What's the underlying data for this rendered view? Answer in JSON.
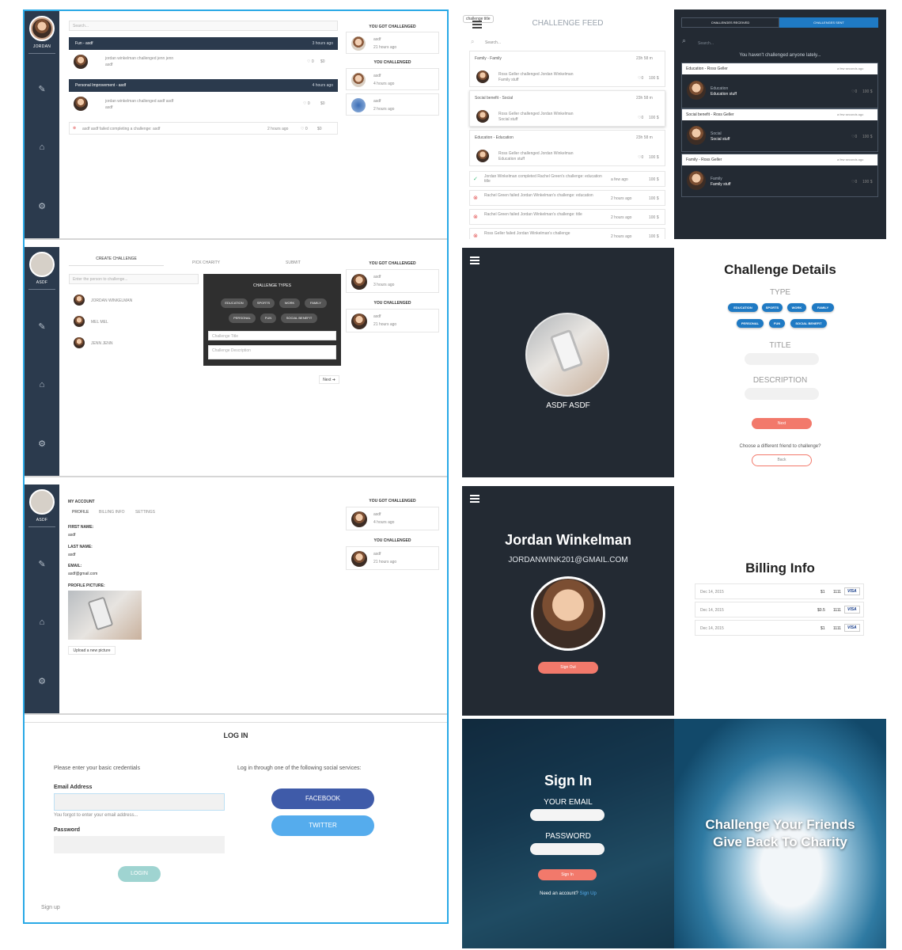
{
  "user": {
    "name": "JORDAN",
    "short": "ASDF"
  },
  "feed1": {
    "search_placeholder": "Search...",
    "groups": [
      {
        "title": "Fun - asdf",
        "time": "3 hours ago",
        "text": "jordan winkelman challenged jenn jenn",
        "sub": "asdf",
        "likes": "0",
        "amount": "$0",
        "money": "$0"
      },
      {
        "title": "Personal Improvement - asdf",
        "time": "4 hours ago",
        "text": "jordan winkelman challenged asdf asdf",
        "sub": "asdf",
        "likes": "0",
        "money": "$0"
      }
    ],
    "failed_text": "asdf asdf failed completing a challenge: asdf",
    "failed_time": "2 hours ago",
    "failed_likes": "0",
    "failed_money": "$0"
  },
  "right_col": {
    "got_challenged": "YOU GOT CHALLENGED",
    "you_challenged": "YOU CHALLENGED",
    "item_text": "asdf",
    "times": [
      "21 hours ago",
      "4 hours ago",
      "2 hours ago",
      "3 hours ago",
      "21 hours ago",
      "4 hours ago"
    ]
  },
  "create": {
    "tabs": [
      "CREATE CHALLENGE",
      "PICK CHARITY",
      "SUBMIT"
    ],
    "search_placeholder": "Enter the person to challenge...",
    "people": [
      "JORDAN WINKELMAN",
      "MEL MEL",
      "JENN JENN"
    ],
    "types_title": "CHALLENGE TYPES",
    "types": [
      "EDUCATION",
      "SPORTS",
      "WORK",
      "FAMILY",
      "PERSONAL",
      "FUN",
      "SOCIAL BENEFIT"
    ],
    "title_placeholder": "Challenge Title",
    "desc_placeholder": "Challenge Description",
    "next": "Next"
  },
  "account": {
    "title": "MY ACCOUNT",
    "tabs": [
      "PROFILE",
      "BILLING INFO",
      "SETTINGS"
    ],
    "first_label": "FIRST NAME:",
    "first_val": "asdf",
    "last_label": "LAST NAME:",
    "last_val": "asdf",
    "email_label": "EMAIL:",
    "email_val": "asdf@gmail.com",
    "pic_label": "PROFILE PICTURE:",
    "upload": "Upload a new picture"
  },
  "login": {
    "title": "LOG IN",
    "left_hint": "Please enter your basic credentials",
    "right_hint": "Log in through one of the following social services:",
    "email_label": "Email Address",
    "error": "You forgot to enter your email address...",
    "password_label": "Password",
    "facebook": "FACEBOOK",
    "twitter": "TWITTER",
    "login": "LOGIN",
    "signup": "Sign up"
  },
  "mobile_feed": {
    "tooltip": "challenge title",
    "title": "CHALLENGE FEED",
    "search_placeholder": "Search...",
    "groups": [
      {
        "title": "Family - Family",
        "time": "23h 58 m",
        "text": "Ross Geller challenged Jordan Winkelman",
        "sub": "Family stuff",
        "money": "100 $"
      },
      {
        "title": "Social benefit - Social",
        "time": "23h 58 m",
        "text": "Ross Geller challenged Jordan Winkelman",
        "sub": "Social stuff",
        "money": "100 $"
      },
      {
        "title": "Education - Education",
        "time": "23h 58 m",
        "text": "Ross Geller challenged Jordan Winkelman",
        "sub": "Education stuff",
        "money": "100 $"
      }
    ],
    "events": [
      {
        "text": "Jordan Winkelman completed Rachel Green's challenge: education title",
        "time": "a few ago",
        "money": "100 $",
        "ok": true
      },
      {
        "text": "Rachel Green failed Jordan Winkelman's challenge: education",
        "time": "2 hours ago",
        "money": "100 $",
        "ok": false
      },
      {
        "text": "Rachel Green failed Jordan Winkelman's challenge: title",
        "time": "2 hours ago",
        "money": "100 $",
        "ok": false
      },
      {
        "text": "Ross Geller failed Jordan Winkelman's challenge",
        "time": "2 hours ago",
        "money": "100 $",
        "ok": false
      }
    ]
  },
  "sent": {
    "tab_received": "CHALLENGES RECEIVED",
    "tab_sent": "CHALLENGES SENT",
    "search_placeholder": "Search...",
    "empty": "You haven't challenged anyone lately...",
    "items": [
      {
        "title": "Education - Ross Geller",
        "time": "a few seconds ago",
        "name": "Education",
        "sub": "Education stuff",
        "money": "100 $"
      },
      {
        "title": "Social benefit - Ross Geller",
        "time": "a few seconds ago",
        "name": "Social",
        "sub": "Social stuff",
        "money": "100 $"
      },
      {
        "title": "Family - Ross Geller",
        "time": "a few seconds ago",
        "name": "Family",
        "sub": "Family stuff",
        "money": "100 $"
      }
    ]
  },
  "profile_mobile": {
    "name": "ASDF ASDF"
  },
  "details": {
    "title": "Challenge Details",
    "type_label": "TYPE",
    "types": [
      "EDUCATION",
      "SPORTS",
      "WORK",
      "FAMILY",
      "PERSONAL",
      "FUN",
      "SOCIAL BENEFIT"
    ],
    "title_label": "TITLE",
    "desc_label": "DESCRIPTION",
    "next": "Next",
    "question": "Choose a different friend to challenge?",
    "back": "Back"
  },
  "jordan": {
    "name": "Jordan Winkelman",
    "email": "JORDANWINK201@GMAIL.COM",
    "signout": "Sign Out"
  },
  "billing": {
    "title": "Billing Info",
    "rows": [
      {
        "date": "Dec 14, 2015",
        "amount": "$1",
        "card": "1111",
        "brand": "VISA"
      },
      {
        "date": "Dec 14, 2015",
        "amount": "$0.5",
        "card": "1111",
        "brand": "VISA"
      },
      {
        "date": "Dec 14, 2015",
        "amount": "$1",
        "card": "1111",
        "brand": "VISA"
      }
    ]
  },
  "signin": {
    "title": "Sign In",
    "email_label": "YOUR EMAIL",
    "password_label": "PASSWORD",
    "button": "Sign In",
    "need": "Need an account?",
    "signup": "Sign Up",
    "tagline1": "Challenge Your Friends",
    "tagline2": "Give Back To Charity"
  },
  "colors": {
    "sidebar": "#2b3a4d",
    "dark_bg": "#232a33",
    "accent_blue": "#1f7ac4",
    "salmon": "#f2796b",
    "facebook": "#3f5ba9",
    "twitter": "#55aced",
    "selection": "#29a9e6"
  }
}
